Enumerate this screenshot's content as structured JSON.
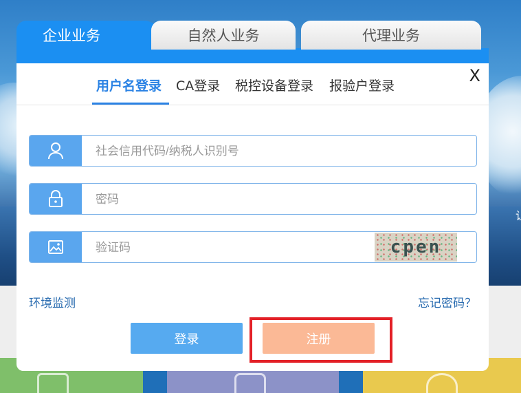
{
  "tabs": [
    "企业业务",
    "自然人业务",
    "代理业务"
  ],
  "close_label": "X",
  "login_methods": [
    "用户名登录",
    "CA登录",
    "税控设备登录",
    "报验户登录"
  ],
  "fields": {
    "taxpayer_id": {
      "placeholder": "社会信用代码/纳税人识别号",
      "value": "",
      "icon": "user-icon"
    },
    "password": {
      "placeholder": "密码",
      "value": "",
      "icon": "lock-icon"
    },
    "captcha": {
      "placeholder": "验证码",
      "value": "",
      "icon": "image-icon",
      "captcha_text": "cpen"
    }
  },
  "links": {
    "env_check": "环境监测",
    "forgot_password": "忘记密码？"
  },
  "buttons": {
    "login": "登录",
    "register": "注册"
  },
  "background": {
    "side_text": "让"
  },
  "colors": {
    "accent": "#1b8ff2",
    "login_button": "#56aaf0",
    "register_button": "#fbb996",
    "highlight": "#e32027"
  }
}
